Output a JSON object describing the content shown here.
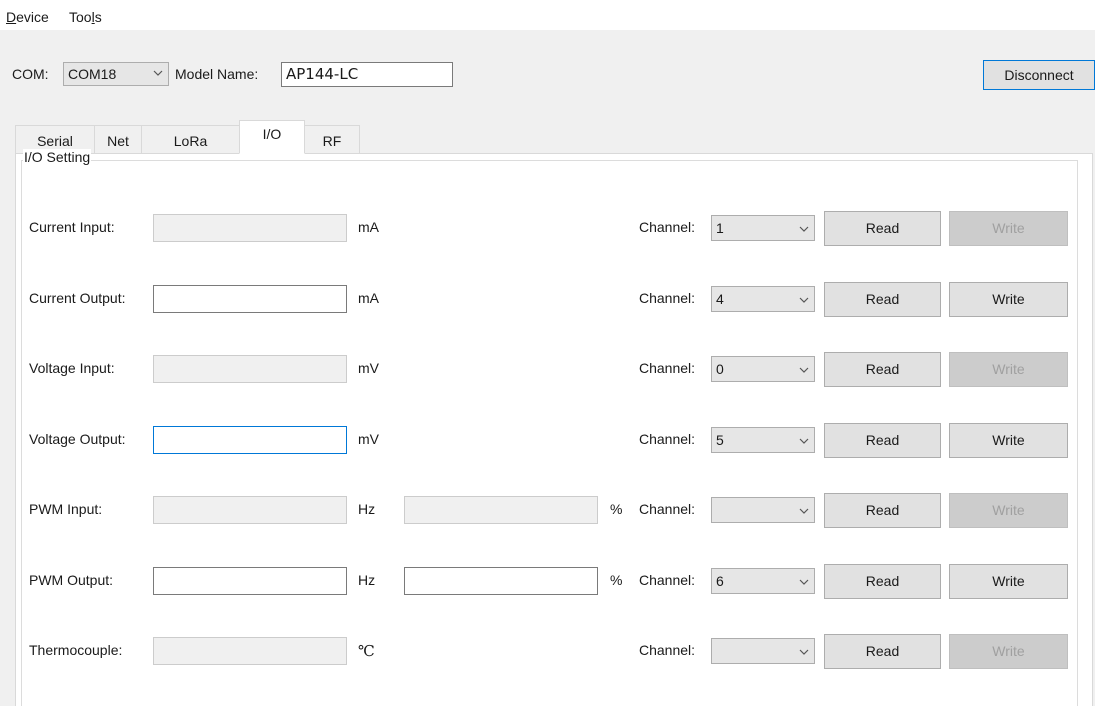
{
  "menu": [
    {
      "label": "Device",
      "accel": "D",
      "rest": "evice"
    },
    {
      "label": "Tools",
      "pre": "Too",
      "accel": "l",
      "rest": "s"
    }
  ],
  "toolbar": {
    "com_label": "COM:",
    "com_value": "COM18",
    "model_label": "Model Name:",
    "model_value": "AP144-LC",
    "disconnect_label": "Disconnect"
  },
  "tabs": [
    "Serial",
    "Net",
    "LoRa",
    "I/O",
    "RF"
  ],
  "active_tab": "I/O",
  "group_title": "I/O Setting",
  "channel_label": "Channel:",
  "read_label": "Read",
  "write_label": "Write",
  "rows": [
    {
      "label": "Current Input:",
      "unit": "mA",
      "channel": "1",
      "editable": false,
      "write_enabled": false
    },
    {
      "label": "Current Output:",
      "unit": "mA",
      "channel": "4",
      "editable": true,
      "write_enabled": true
    },
    {
      "label": "Voltage Input:",
      "unit": "mV",
      "channel": "0",
      "editable": false,
      "write_enabled": false
    },
    {
      "label": "Voltage Output:",
      "unit": "mV",
      "channel": "5",
      "editable": true,
      "write_enabled": true,
      "focused": true
    },
    {
      "label": "PWM Input:",
      "unit": "Hz",
      "unit2": "%",
      "channel": "",
      "editable": false,
      "write_enabled": false
    },
    {
      "label": "PWM Output:",
      "unit": "Hz",
      "unit2": "%",
      "channel": "6",
      "editable": true,
      "write_enabled": true
    },
    {
      "label": "Thermocouple:",
      "unit": "℃",
      "channel": "",
      "editable": false,
      "write_enabled": false
    }
  ],
  "colors": {
    "window_bg": "#f0f0f0",
    "panel_bg": "#ffffff",
    "button_bg": "#e1e1e1",
    "disabled_button_bg": "#cccccc",
    "focus_border": "#0078d7"
  }
}
